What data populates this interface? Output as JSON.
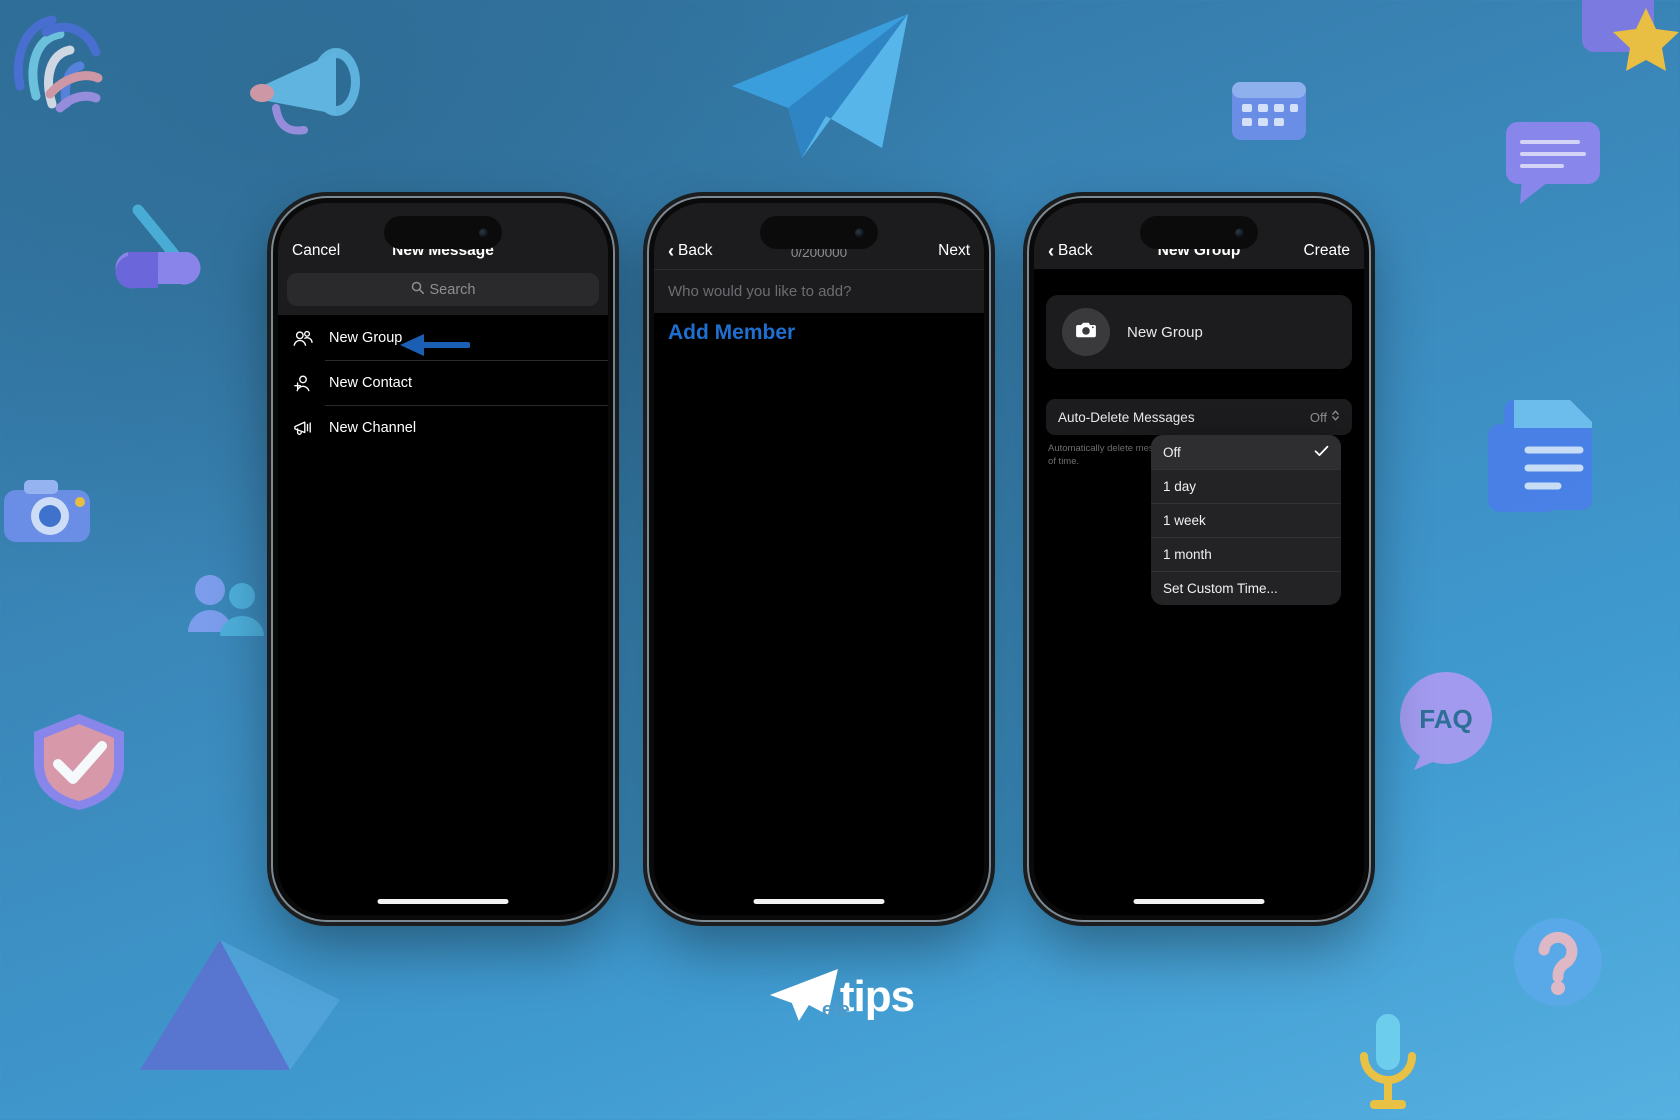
{
  "background": {
    "gradient_from": "#2e6f9a",
    "gradient_to": "#56b0e0",
    "decor": [
      {
        "name": "fingerprint-icon"
      },
      {
        "name": "megaphone-icon"
      },
      {
        "name": "paper-plane-icon"
      },
      {
        "name": "calendar-icon"
      },
      {
        "name": "star-badge-icon"
      },
      {
        "name": "chat-bubble-icon"
      },
      {
        "name": "mortar-pestle-icon"
      },
      {
        "name": "camera-icon"
      },
      {
        "name": "people-icon"
      },
      {
        "name": "shield-check-icon"
      },
      {
        "name": "document-icon"
      },
      {
        "name": "faq-bubble-icon"
      },
      {
        "name": "question-mark-icon"
      },
      {
        "name": "microphone-icon"
      },
      {
        "name": "triangle-icon"
      }
    ],
    "faq_label": "FAQ"
  },
  "logo": {
    "brand": "tips",
    "prefix": "ele",
    "icon": "paper-plane-icon"
  },
  "phone1": {
    "nav": {
      "left_label": "Cancel",
      "title": "New Message"
    },
    "search": {
      "placeholder": "Search",
      "icon": "search-icon"
    },
    "rows": [
      {
        "label": "New Group",
        "icon": "people-group-icon"
      },
      {
        "label": "New Contact",
        "icon": "person-add-icon"
      },
      {
        "label": "New Channel",
        "icon": "megaphone-icon"
      }
    ],
    "annotation": {
      "name": "arrow-annotation",
      "color": "#1b5fb4"
    }
  },
  "phone2": {
    "nav": {
      "back_label": "Back",
      "counter": "0/200000",
      "right_label": "Next"
    },
    "member_field": {
      "placeholder": "Who would you like to add?"
    },
    "section_title": "Add Member",
    "accent": "#1f6fd0"
  },
  "phone3": {
    "nav": {
      "back_label": "Back",
      "title": "New Group",
      "right_label": "Create"
    },
    "group_card": {
      "avatar_icon": "camera-icon",
      "name": "New Group"
    },
    "setting": {
      "label": "Auto-Delete Messages",
      "value": "Off",
      "chevron_icon": "chevron-up-down-icon",
      "description": "Automatically delete messages after a period of time."
    },
    "dropdown": {
      "items": [
        {
          "label": "Off",
          "selected": true
        },
        {
          "label": "1 day",
          "selected": false
        },
        {
          "label": "1 week",
          "selected": false
        },
        {
          "label": "1 month",
          "selected": false
        },
        {
          "label": "Set Custom Time...",
          "selected": false
        }
      ],
      "check_icon": "checkmark-icon"
    }
  }
}
